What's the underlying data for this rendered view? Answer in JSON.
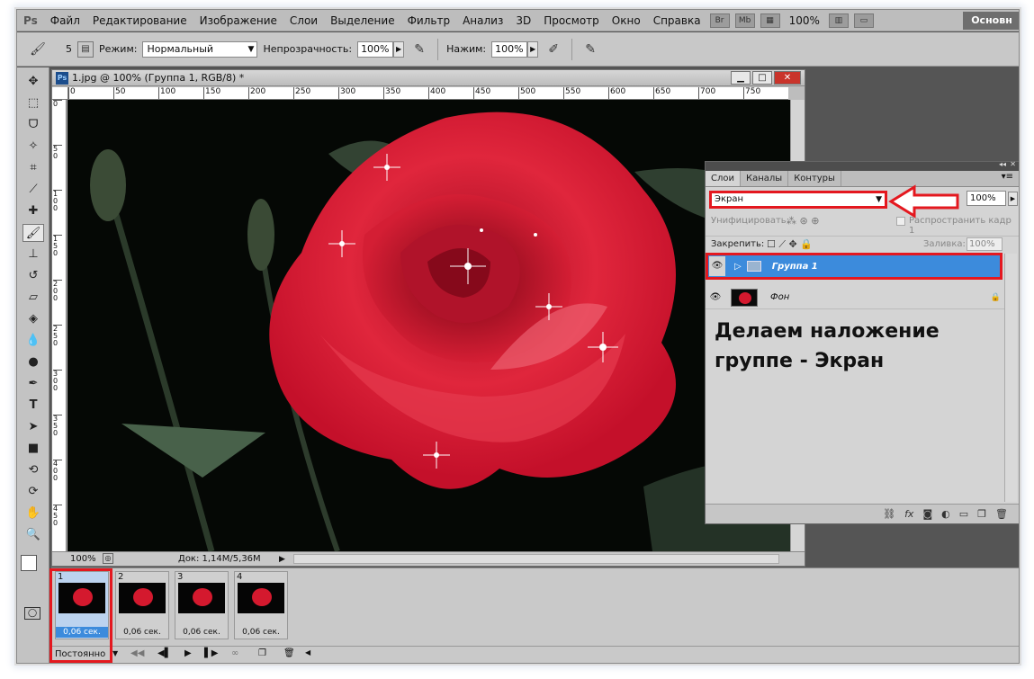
{
  "menu": {
    "app_icon": "Ps",
    "items": [
      "Файл",
      "Редактирование",
      "Изображение",
      "Слои",
      "Выделение",
      "Фильтр",
      "Анализ",
      "3D",
      "Просмотр",
      "Окно",
      "Справка"
    ],
    "zoom": "100%",
    "workspace": "Основн"
  },
  "options": {
    "brush_size": "5",
    "mode_label": "Режим:",
    "mode_value": "Нормальный",
    "opacity_label": "Непрозрачность:",
    "opacity_value": "100%",
    "flow_label": "Нажим:",
    "flow_value": "100%"
  },
  "document": {
    "title": "1.jpg @ 100% (Группа 1, RGB/8) *",
    "ps_badge": "Ps",
    "ruler_h": [
      "0",
      "50",
      "100",
      "150",
      "200",
      "250",
      "300",
      "350",
      "400",
      "450",
      "500",
      "550",
      "600",
      "650",
      "700",
      "750"
    ],
    "ruler_v": [
      "0",
      "50",
      "100",
      "150",
      "200",
      "250",
      "300",
      "350",
      "400",
      "450"
    ],
    "zoom": "100%",
    "doc_size": "Док: 1,14M/5,36M"
  },
  "layers": {
    "tabs": [
      "Слои",
      "Каналы",
      "Контуры"
    ],
    "blend_mode": "Экран",
    "opacity_value": "100%",
    "unify_label": "Унифицировать:",
    "propagate_label": "Распространить кадр 1",
    "lock_label": "Закрепить:",
    "fill_label": "Заливка:",
    "fill_value": "100%",
    "items": [
      {
        "name": "Группа 1",
        "selected": true
      },
      {
        "name": "Фон",
        "selected": false
      }
    ],
    "note_line1": "Делаем наложение",
    "note_line2": "группе - Экран"
  },
  "animation": {
    "frames": [
      {
        "num": "1",
        "delay": "0,06 сек."
      },
      {
        "num": "2",
        "delay": "0,06 сек."
      },
      {
        "num": "3",
        "delay": "0,06 сек."
      },
      {
        "num": "4",
        "delay": "0,06 сек."
      }
    ],
    "loop": "Постоянно"
  },
  "colors": {
    "highlight": "#e4181f",
    "selection": "#3c8bdc",
    "rose": "#d4192e"
  }
}
